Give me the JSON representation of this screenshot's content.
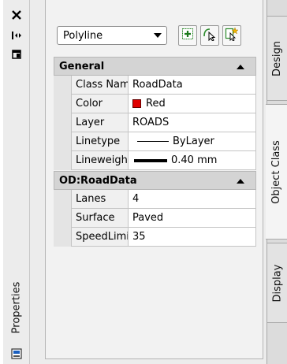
{
  "palette": {
    "title": "Properties"
  },
  "toolbar": {
    "object_type": "Polyline"
  },
  "categories": [
    {
      "label": "General",
      "rows": [
        {
          "name": "Class Name",
          "value": "RoadData"
        },
        {
          "name": "Color",
          "value": "Red"
        },
        {
          "name": "Layer",
          "value": "ROADS"
        },
        {
          "name": "Linetype",
          "value": "ByLayer"
        },
        {
          "name": "Lineweight",
          "value": "0.40 mm"
        }
      ]
    },
    {
      "label": "OD:RoadData",
      "rows": [
        {
          "name": "Lanes",
          "value": "4"
        },
        {
          "name": "Surface",
          "value": "Paved"
        },
        {
          "name": "SpeedLimit",
          "value": "35"
        }
      ]
    }
  ],
  "tabs": {
    "design": "Design",
    "object_class": "Object Class",
    "display": "Display"
  },
  "colors": {
    "color_swatch": "#e00000"
  },
  "icons": {
    "close": "close-icon",
    "autohide": "autohide-icon",
    "menu": "palette-menu-icon",
    "quick_select": "quick-select-icon",
    "select_objects": "select-objects-icon",
    "toggle_pickadd": "toggle-pickadd-icon",
    "bottom": "palette-settings-icon"
  }
}
